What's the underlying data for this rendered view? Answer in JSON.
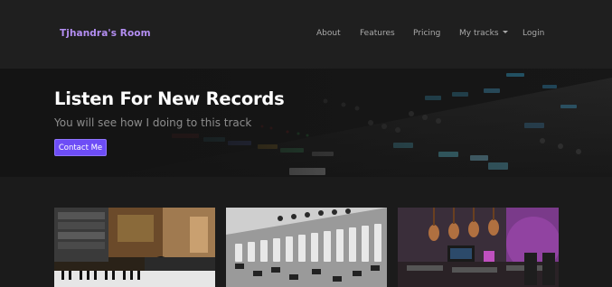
{
  "navbar": {
    "brand": "Tjhandra's Room",
    "links": [
      {
        "label": "About"
      },
      {
        "label": "Features"
      },
      {
        "label": "Pricing"
      },
      {
        "label": "My tracks",
        "dropdown": true
      },
      {
        "label": "Login"
      }
    ]
  },
  "hero": {
    "title": "Listen For New Records",
    "subtitle": "You will see how I doing to this track",
    "button_label": "Contact Me"
  },
  "colors": {
    "accent": "#6d4df6",
    "brand": "#b48ef2",
    "background": "#1c1c1c"
  },
  "cards": [
    {
      "image": "recording-studio-keyboard-photo"
    },
    {
      "image": "mixing-console-faders-bw-photo"
    },
    {
      "image": "studio-guitars-wall-purple-photo"
    }
  ]
}
